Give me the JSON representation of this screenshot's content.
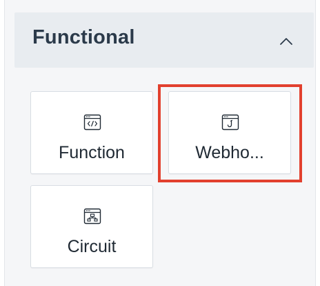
{
  "section": {
    "title": "Functional",
    "expanded": true,
    "chevron_icon": "chevron-up-icon"
  },
  "tiles": [
    {
      "label": "Function",
      "icon": "code-window-icon"
    },
    {
      "label": "Webho...",
      "icon": "webhook-window-icon",
      "highlighted": true
    },
    {
      "label": "Circuit",
      "icon": "circuit-window-icon"
    }
  ],
  "colors": {
    "highlight": "#e2402e",
    "header_bg": "#e8ecf0",
    "panel_bg": "#f5f6f8",
    "title_text": "#2b3a4a"
  }
}
